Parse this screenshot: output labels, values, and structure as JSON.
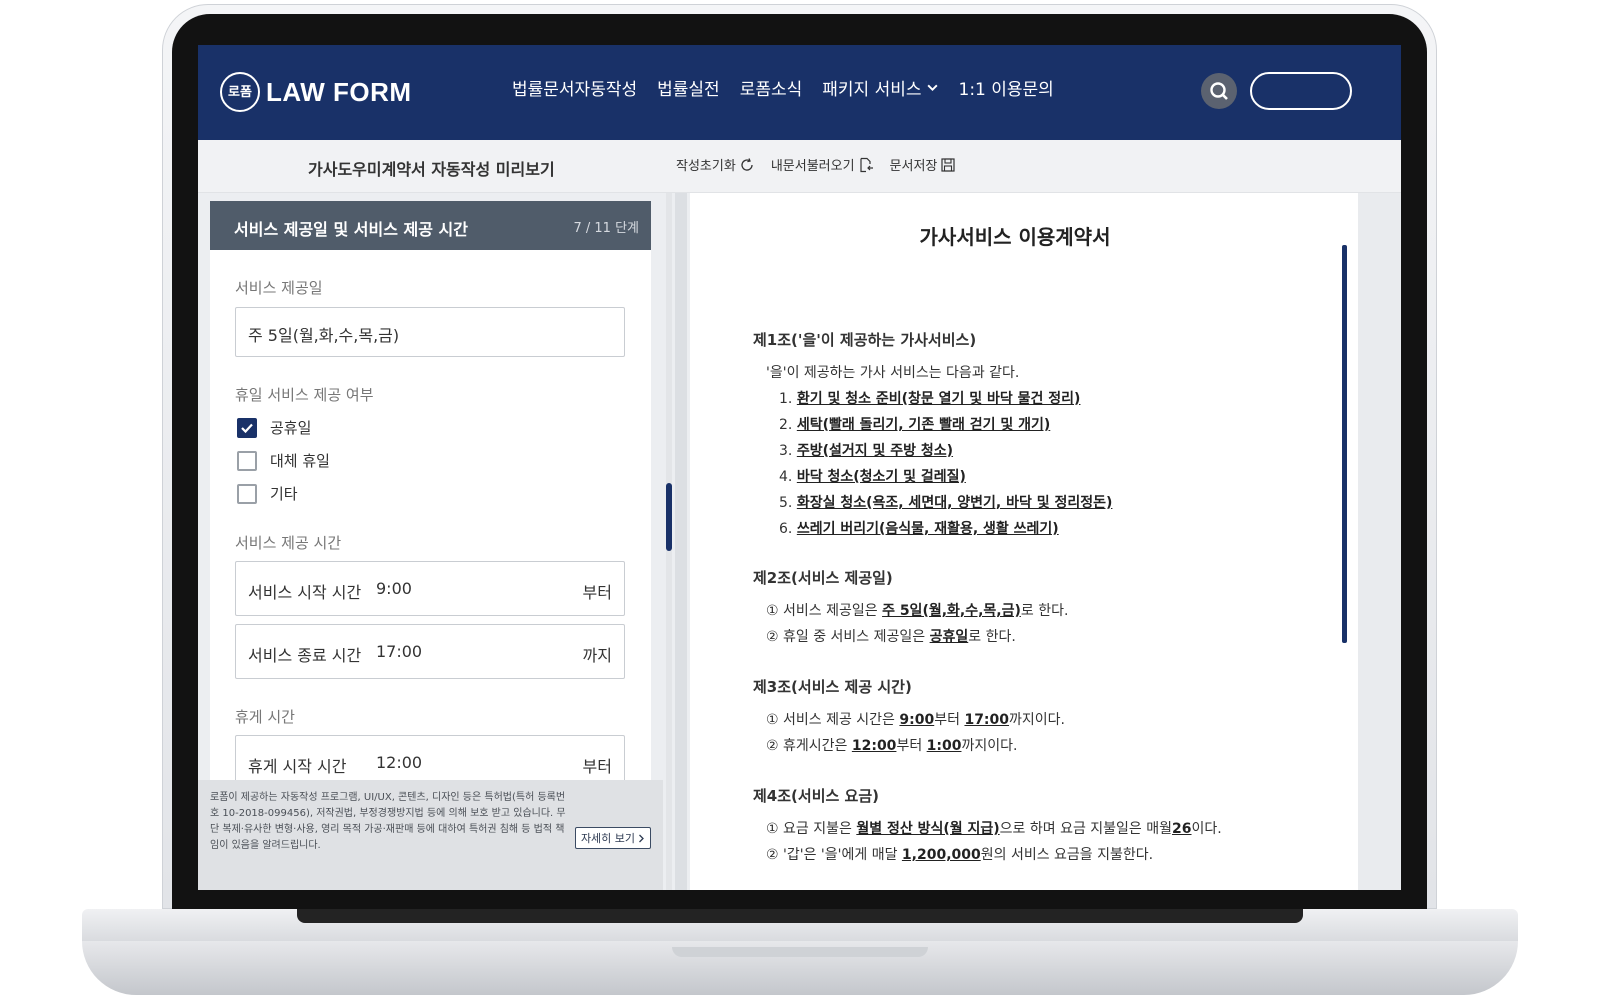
{
  "header": {
    "logo_mark": "로폼",
    "logo_text": "LAW FORM",
    "nav": [
      "법률문서자동작성",
      "법률실전",
      "로폼소식",
      "패키지 서비스",
      "1:1 이용문의"
    ]
  },
  "subbar": {
    "title": "가사도우미계약서 자동작성 미리보기",
    "tools": {
      "reset": "작성초기화",
      "load": "내문서불러오기",
      "save": "문서저장"
    }
  },
  "form": {
    "step_title": "서비스 제공일 및 서비스 제공 시간",
    "step_count": "7 / 11 단계",
    "service_day_label": "서비스 제공일",
    "service_day_value": "주 5일(월,화,수,목,금)",
    "holiday_label": "휴일 서비스 제공 여부",
    "options": [
      {
        "label": "공휴일",
        "checked": true
      },
      {
        "label": "대체 휴일",
        "checked": false
      },
      {
        "label": "기타",
        "checked": false
      }
    ],
    "service_time_label": "서비스 제공 시간",
    "start_label": "서비스 시작 시간",
    "start_value": "9:00",
    "start_suffix": "부터",
    "end_label": "서비스 종료 시간",
    "end_value": "17:00",
    "end_suffix": "까지",
    "break_label": "휴게 시간",
    "break_start_label": "휴게 시작 시간",
    "break_start_value": "12:00",
    "break_start_suffix": "부터"
  },
  "notice": {
    "text": "로폼이 제공하는 자동작성 프로그램, UI/UX, 콘텐츠, 디자인 등은 특허법(특허 등록번호 10-2018-099456), 저작권법, 부정경쟁방지법 등에 의해 보호 받고 있습니다. 무단 복제·유사한 변형·사용, 영리 목적 가공·재판매 등에 대하여 특허권 침해 등 법적 책임이 있음을 알려드립니다.",
    "more_button": "자세히 보기"
  },
  "document": {
    "title": "가사서비스 이용계약서",
    "a1": {
      "heading": "제1조('을'이 제공하는 가사서비스)",
      "intro": "'을'이 제공하는 가사 서비스는 다음과 같다.",
      "items": [
        {
          "num": "1.",
          "text": "환기 및 청소 준비(창문 열기 및 바닥 물건 정리)"
        },
        {
          "num": "2.",
          "text": "세탁(빨래 돌리기, 기존 빨래 걷기 및 개기)"
        },
        {
          "num": "3.",
          "text": "주방(설거지 및 주방 청소)"
        },
        {
          "num": "4.",
          "text": "바닥 청소(청소기 및 걸레질)"
        },
        {
          "num": "5.",
          "text": "화장실 청소(욕조, 세면대, 양변기, 바닥 및 정리정돈)"
        },
        {
          "num": "6.",
          "text": "쓰레기 버리기(음식물, 재활용, 생활 쓰레기)"
        }
      ]
    },
    "a2": {
      "heading": "제2조(서비스 제공일)",
      "l1_pre": "① 서비스 제공일은 ",
      "l1_val": "주 5일(월,화,수,목,금)",
      "l1_post": "로 한다.",
      "l2_pre": "② 휴일 중 서비스 제공일은 ",
      "l2_val": "공휴일",
      "l2_post": "로 한다."
    },
    "a3": {
      "heading": "제3조(서비스 제공 시간)",
      "l1_pre": "① 서비스 제공 시간은 ",
      "l1_v1": "9:00",
      "l1_mid": "부터 ",
      "l1_v2": "17:00",
      "l1_post": "까지이다.",
      "l2_pre": "② 휴게시간은 ",
      "l2_v1": "12:00",
      "l2_mid": "부터 ",
      "l2_v2": "1:00",
      "l2_post": "까지이다."
    },
    "a4": {
      "heading": "제4조(서비스 요금)",
      "l1_pre": "① 요금 지불은 ",
      "l1_v1": "월별 정산 방식(월 지급)",
      "l1_mid": "으로 하며 요금 지불일은 매월",
      "l1_v2": "26",
      "l1_post": "이다.",
      "l2_pre": "② '갑'은 '을'에게 매달 ",
      "l2_v1": "1,200,000",
      "l2_post": "원의 서비스 요금을 지불한다."
    }
  }
}
